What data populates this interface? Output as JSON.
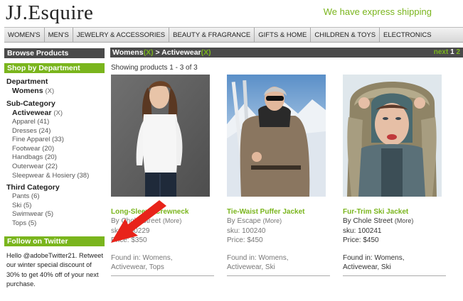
{
  "header": {
    "logo": "JJ.Esquire",
    "shipping": "We have express shipping"
  },
  "topnav": [
    "WOMEN'S",
    "MEN'S",
    "JEWELRY & ACCESSORIES",
    "BEAUTY & FRAGRANCE",
    "GIFTS & HOME",
    "CHILDREN & TOYS",
    "ELECTRONICS"
  ],
  "sidebar": {
    "browse": "Browse Products",
    "shop_by": "Shop by Department",
    "department_title": "Department",
    "department_selected": "Womens",
    "remove": "(X)",
    "subcat_title": "Sub-Category",
    "subcat_selected": "Activewear",
    "subcat_items": [
      "Apparel (41)",
      "Dresses (24)",
      "Fine Apparel (33)",
      "Footwear (20)",
      "Handbags (20)",
      "Outerwear (22)",
      "Sleepwear & Hosiery (38)"
    ],
    "third_title": "Third Category",
    "third_items": [
      "Pants (6)",
      "Ski (5)",
      "Swimwear (5)",
      "Tops (5)"
    ],
    "twitter_head": "Follow on Twitter",
    "twitter_text": "Hello @adobeTwitter21. Retweet our winter special discount of 30% to get 40% off of your next purchase."
  },
  "breadcrumb": {
    "crumb1": "Womens",
    "x": "(X)",
    "sep": ">",
    "crumb2": "Activewear",
    "next": "next",
    "page1": "1",
    "page2": "2"
  },
  "showing": "Showing products 1 - 3 of 3",
  "products": [
    {
      "name": "Long-Sleeve Crewneck",
      "by": "By Chole Street",
      "more": "(More)",
      "sku": "sku: 100229",
      "price": "Price: $350",
      "found1": "Found in: Womens,",
      "found2": "Activewear, Tops"
    },
    {
      "name": "Tie-Waist Puffer Jacket",
      "by": "By Escape",
      "more": "(More)",
      "sku": "sku: 100240",
      "price": "Price: $450",
      "found1": "Found in: Womens,",
      "found2": "Activewear, Ski"
    },
    {
      "name": "Fur-Trim Ski Jacket",
      "by": "By Chole Street",
      "more": "(More)",
      "sku": "sku: 100241",
      "price": "Price: $450",
      "found1": "Found in: Womens,",
      "found2": "Activewear, Ski"
    }
  ],
  "colors": {
    "accent": "#7ab51d",
    "bar": "#4a4a4a",
    "annotation_arrow": "#e8231a"
  }
}
